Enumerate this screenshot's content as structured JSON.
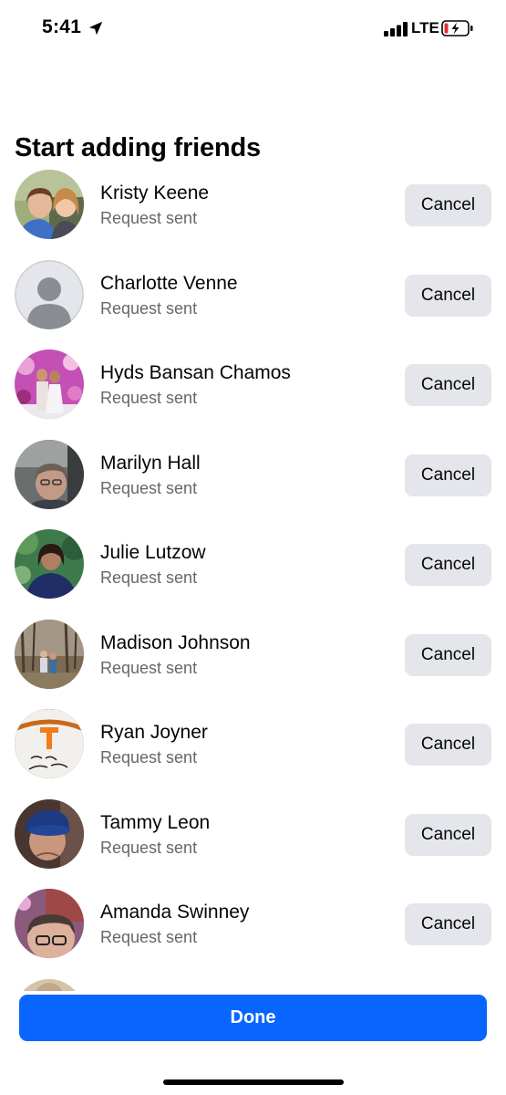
{
  "status_bar": {
    "time": "5:41",
    "network": "LTE",
    "icons": [
      "location-arrow-icon",
      "signal-bars-icon",
      "battery-charging-icon"
    ]
  },
  "section_title": "Start adding friends",
  "friends": [
    {
      "name": "Kristy Keene",
      "status": "Request sent",
      "action": "Cancel"
    },
    {
      "name": "Charlotte Venne",
      "status": "Request sent",
      "action": "Cancel"
    },
    {
      "name": "Hyds Bansan Chamos",
      "status": "Request sent",
      "action": "Cancel"
    },
    {
      "name": "Marilyn Hall",
      "status": "Request sent",
      "action": "Cancel"
    },
    {
      "name": "Julie Lutzow",
      "status": "Request sent",
      "action": "Cancel"
    },
    {
      "name": "Madison Johnson",
      "status": "Request sent",
      "action": "Cancel"
    },
    {
      "name": "Ryan Joyner",
      "status": "Request sent",
      "action": "Cancel"
    },
    {
      "name": "Tammy Leon",
      "status": "Request sent",
      "action": "Cancel"
    },
    {
      "name": "Amanda Swinney",
      "status": "Request sent",
      "action": "Cancel"
    }
  ],
  "done_label": "Done",
  "colors": {
    "primary_blue": "#0866ff",
    "secondary_button": "#e4e6eb",
    "secondary_text": "#65676b",
    "battery_low": "#e3302f"
  }
}
